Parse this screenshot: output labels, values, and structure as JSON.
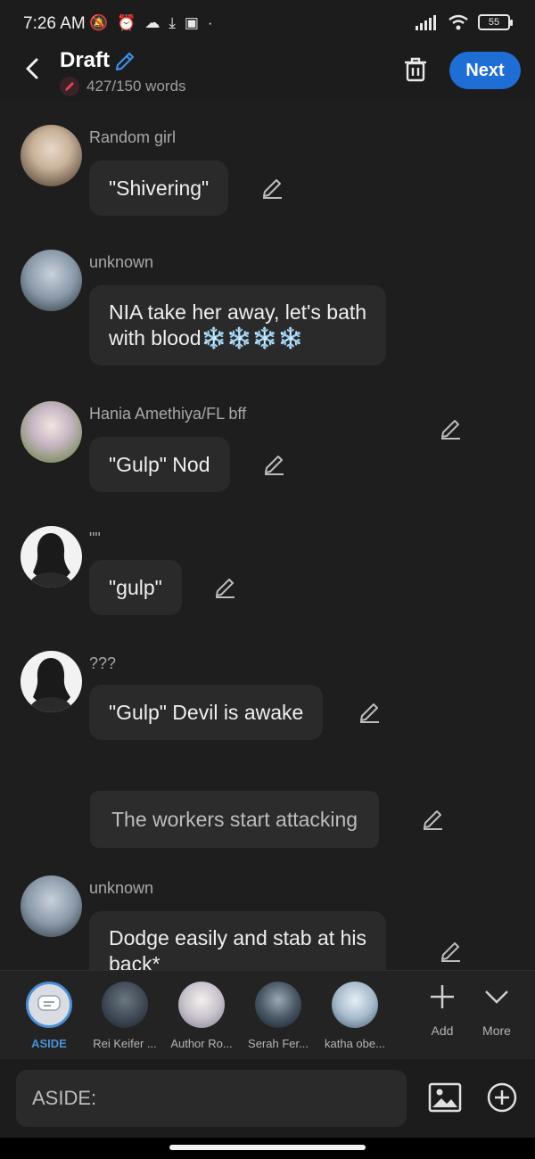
{
  "status_bar": {
    "time": "7:26 AM",
    "battery": "55"
  },
  "header": {
    "title": "Draft",
    "word_count": "427/150 words",
    "next_label": "Next"
  },
  "messages": [
    {
      "name": "Random girl",
      "text": "\"Shivering\""
    },
    {
      "name": "unknown",
      "text_line1": "NIA take her away, let's bath",
      "text_line2": "with blood❄️❄️❄️❄️"
    },
    {
      "name": "Hania Amethiya/FL bff",
      "text": "\"Gulp\" Nod"
    },
    {
      "name": "\"\"",
      "text": "\"gulp\""
    },
    {
      "name": "???",
      "text": "\"Gulp\" Devil is awake"
    },
    {
      "narration": "The workers start attacking"
    },
    {
      "name": "unknown",
      "text_line1": "Dodge easily and stab at his",
      "text_line2": "back*"
    }
  ],
  "characters": [
    {
      "label": "ASIDE"
    },
    {
      "label": "Rei Keifer ..."
    },
    {
      "label": "Author Ro..."
    },
    {
      "label": "Serah Fer..."
    },
    {
      "label": "katha obe..."
    }
  ],
  "actions": {
    "add_label": "Add",
    "more_label": "More"
  },
  "input": {
    "placeholder": "ASIDE:"
  },
  "colors": {
    "accent": "#1e6ed6",
    "aside_accent": "#4a8fd8",
    "background": "#1e1e1e",
    "bubble": "#2a2a2a"
  }
}
